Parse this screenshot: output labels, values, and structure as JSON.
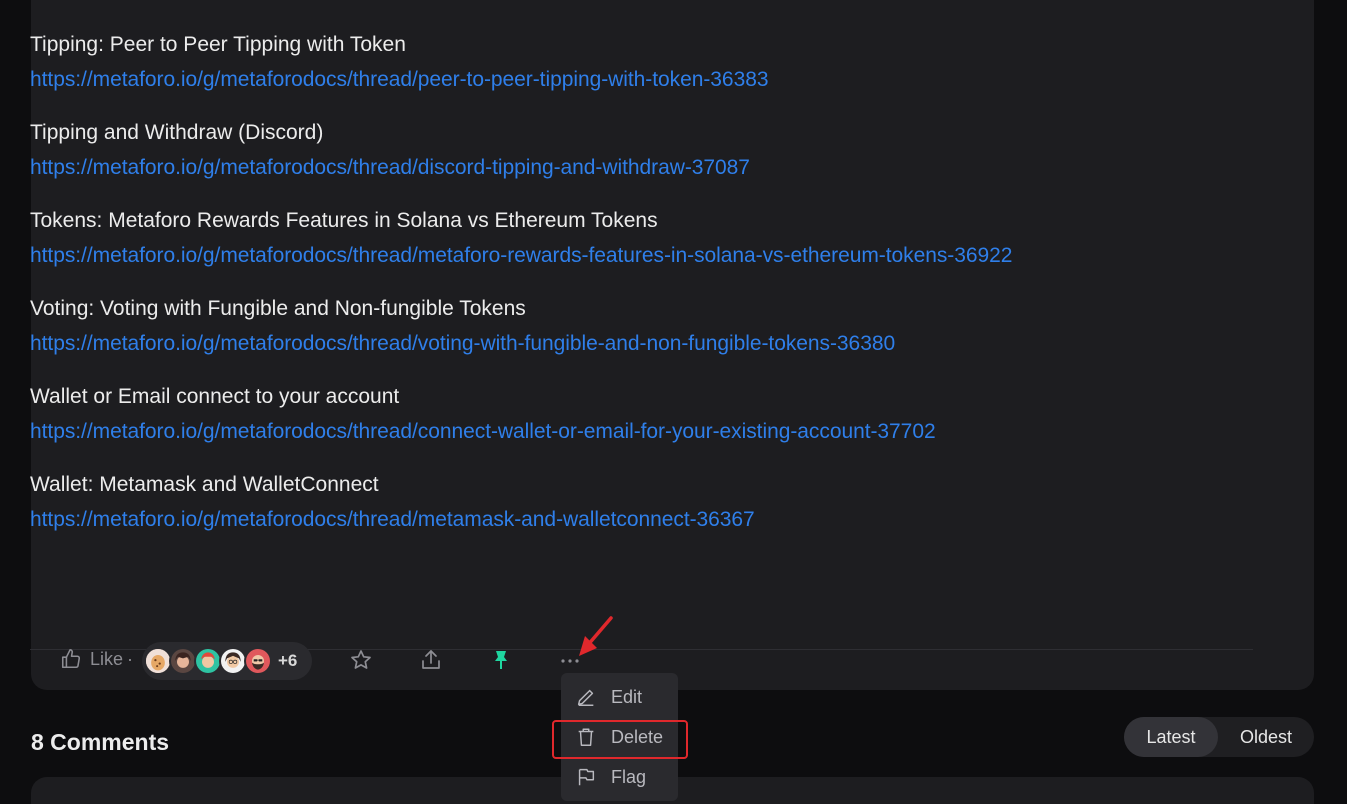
{
  "entries": [
    {
      "title": "Tipping: Peer to Peer Tipping with Token",
      "url": "https://metaforo.io/g/metaforodocs/thread/peer-to-peer-tipping-with-token-36383"
    },
    {
      "title": "Tipping and Withdraw (Discord)",
      "url": "https://metaforo.io/g/metaforodocs/thread/discord-tipping-and-withdraw-37087"
    },
    {
      "title": "Tokens: Metaforo Rewards Features in Solana vs Ethereum Tokens",
      "url": "https://metaforo.io/g/metaforodocs/thread/metaforo-rewards-features-in-solana-vs-ethereum-tokens-36922"
    },
    {
      "title": "Voting: Voting with Fungible and Non-fungible Tokens",
      "url": "https://metaforo.io/g/metaforodocs/thread/voting-with-fungible-and-non-fungible-tokens-36380"
    },
    {
      "title": "Wallet or Email connect to your account",
      "url": "https://metaforo.io/g/metaforodocs/thread/connect-wallet-or-email-for-your-existing-account-37702"
    },
    {
      "title": "Wallet: Metamask and WalletConnect",
      "url": "https://metaforo.io/g/metaforodocs/thread/metamask-and-walletconnect-36367"
    }
  ],
  "actions": {
    "like_label": "Like",
    "like_separator": "·",
    "avatars_extra": "+6",
    "star_icon": "star-icon",
    "share_icon": "share-icon",
    "pin_icon": "pin-icon",
    "more_icon": "more-icon",
    "pin_color": "#1fd6a0"
  },
  "menu": {
    "edit_label": "Edit",
    "delete_label": "Delete",
    "flag_label": "Flag"
  },
  "comments": {
    "title": "8 Comments",
    "sort_latest": "Latest",
    "sort_oldest": "Oldest"
  },
  "colors": {
    "link": "#2f7fea",
    "highlight": "#e0282c",
    "card": "#1d1d20",
    "background": "#0d0d0f"
  }
}
